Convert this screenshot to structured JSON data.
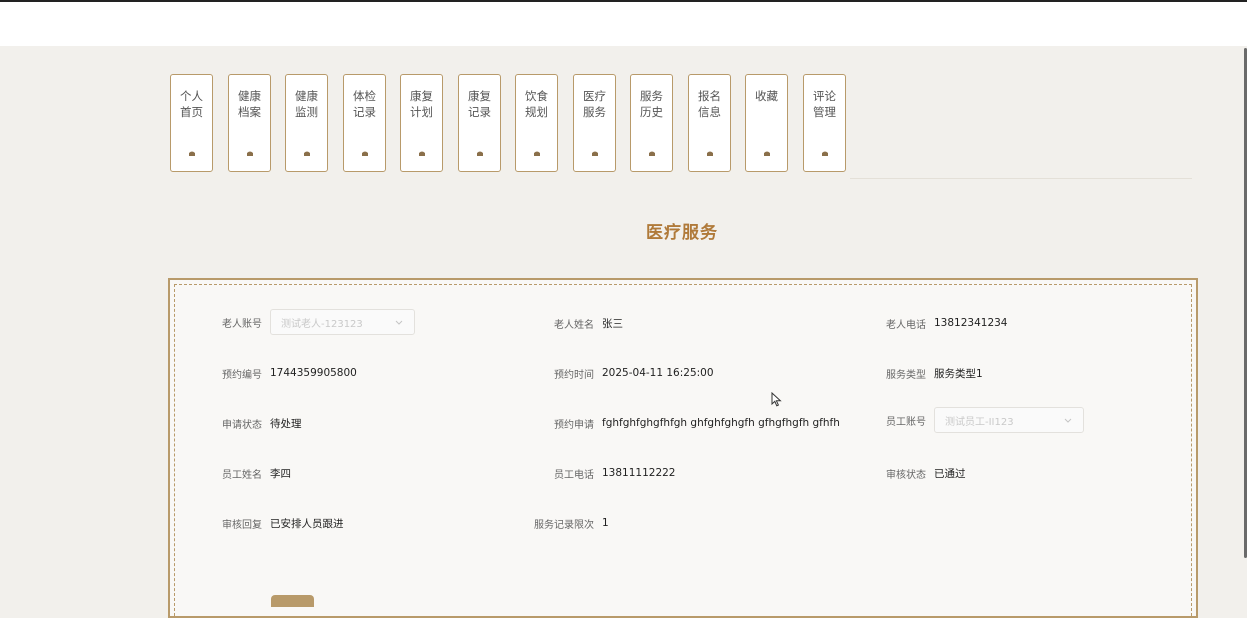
{
  "nav": {
    "tabs": [
      {
        "label": "个人\n首页"
      },
      {
        "label": "健康\n档案"
      },
      {
        "label": "健康\n监测"
      },
      {
        "label": "体检\n记录"
      },
      {
        "label": "康复\n计划"
      },
      {
        "label": "康复\n记录"
      },
      {
        "label": "饮食\n规划"
      },
      {
        "label": "医疗\n服务"
      },
      {
        "label": "服务\n历史"
      },
      {
        "label": "报名\n信息"
      },
      {
        "label": "收藏"
      },
      {
        "label": "评论\n管理"
      }
    ],
    "tab_icon": "bell-icon"
  },
  "page": {
    "title": "医疗服务"
  },
  "form": {
    "elder_account": {
      "label": "老人账号",
      "placeholder": "测试老人-123123"
    },
    "elder_name": {
      "label": "老人姓名",
      "value": "张三"
    },
    "elder_phone": {
      "label": "老人电话",
      "value": "13812341234"
    },
    "booking_no": {
      "label": "预约编号",
      "value": "1744359905800"
    },
    "booking_time": {
      "label": "预约时间",
      "value": "2025-04-11 16:25:00"
    },
    "service_type": {
      "label": "服务类型",
      "value": "服务类型1"
    },
    "apply_status": {
      "label": "申请状态",
      "value": "待处理"
    },
    "booking_request": {
      "label": "预约申请",
      "value": "fghfghfghgfhfgh ghfghfghgfh gfhgfhgfh gfhfh"
    },
    "staff_account": {
      "label": "员工账号",
      "placeholder": "测试员工-II123"
    },
    "staff_name": {
      "label": "员工姓名",
      "value": "李四"
    },
    "staff_phone": {
      "label": "员工电话",
      "value": "13811112222"
    },
    "review_status": {
      "label": "审核状态",
      "value": "已通过"
    },
    "review_reply": {
      "label": "审核回复",
      "value": "已安排人员跟进"
    },
    "service_record_limit": {
      "label": "服务记录限次",
      "value": "1"
    }
  },
  "colors": {
    "accent": "#b89a6a",
    "title": "#b07a3a",
    "background": "#f2f0ec"
  }
}
